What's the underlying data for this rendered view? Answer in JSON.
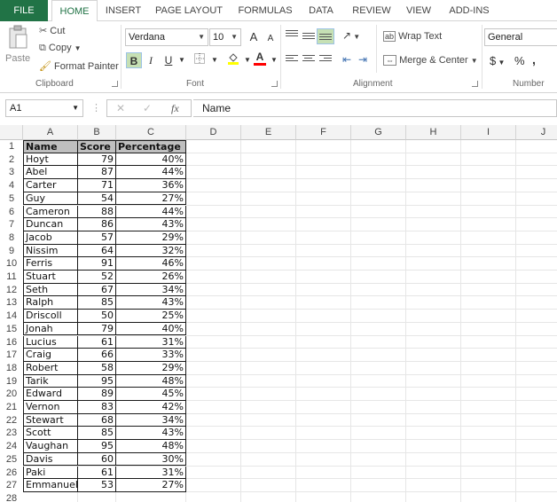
{
  "tabs": {
    "file": "FILE",
    "home": "HOME",
    "insert": "INSERT",
    "page_layout": "PAGE LAYOUT",
    "formulas": "FORMULAS",
    "data": "DATA",
    "review": "REVIEW",
    "view": "VIEW",
    "addins": "ADD-INS"
  },
  "clipboard": {
    "paste": "Paste",
    "cut": "Cut",
    "copy": "Copy",
    "format_painter": "Format Painter",
    "label": "Clipboard"
  },
  "font": {
    "name": "Verdana",
    "size": "10",
    "bold": "B",
    "italic": "I",
    "underline": "U",
    "grow": "A",
    "shrink": "A",
    "font_color": "#ff0000",
    "label": "Font"
  },
  "alignment": {
    "wrap_text": "Wrap Text",
    "merge_center": "Merge & Center",
    "label": "Alignment"
  },
  "number": {
    "format": "General",
    "currency": "$",
    "percent": "%",
    "comma": ",",
    "label": "Number"
  },
  "formula_bar": {
    "name_box": "A1",
    "fx": "fx",
    "value": "Name"
  },
  "columns": [
    "A",
    "B",
    "C",
    "D",
    "E",
    "F",
    "G",
    "H",
    "I",
    "J"
  ],
  "table": {
    "headers": [
      "Name",
      "Score",
      "Percentage"
    ],
    "rows": [
      [
        "Hoyt",
        "79",
        "40%"
      ],
      [
        "Abel",
        "87",
        "44%"
      ],
      [
        "Carter",
        "71",
        "36%"
      ],
      [
        "Guy",
        "54",
        "27%"
      ],
      [
        "Cameron",
        "88",
        "44%"
      ],
      [
        "Duncan",
        "86",
        "43%"
      ],
      [
        "Jacob",
        "57",
        "29%"
      ],
      [
        "Nissim",
        "64",
        "32%"
      ],
      [
        "Ferris",
        "91",
        "46%"
      ],
      [
        "Stuart",
        "52",
        "26%"
      ],
      [
        "Seth",
        "67",
        "34%"
      ],
      [
        "Ralph",
        "85",
        "43%"
      ],
      [
        "Driscoll",
        "50",
        "25%"
      ],
      [
        "Jonah",
        "79",
        "40%"
      ],
      [
        "Lucius",
        "61",
        "31%"
      ],
      [
        "Craig",
        "66",
        "33%"
      ],
      [
        "Robert",
        "58",
        "29%"
      ],
      [
        "Tarik",
        "95",
        "48%"
      ],
      [
        "Edward",
        "89",
        "45%"
      ],
      [
        "Vernon",
        "83",
        "42%"
      ],
      [
        "Stewart",
        "68",
        "34%"
      ],
      [
        "Scott",
        "85",
        "43%"
      ],
      [
        "Vaughan",
        "95",
        "48%"
      ],
      [
        "Davis",
        "60",
        "30%"
      ],
      [
        "Paki",
        "61",
        "31%"
      ],
      [
        "Emmanuel",
        "53",
        "27%"
      ]
    ]
  },
  "colors": {
    "accent": "#217346",
    "header_fill": "#bfbfbf"
  }
}
